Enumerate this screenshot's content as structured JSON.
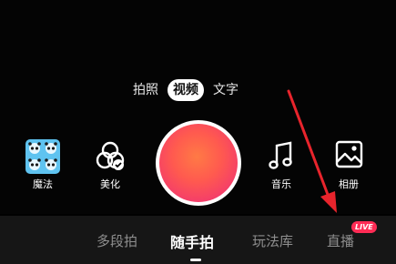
{
  "mode_tabs": {
    "photo": "拍照",
    "video": "视频",
    "text": "文字"
  },
  "tools": {
    "magic": "魔法",
    "beautify": "美化",
    "music": "音乐",
    "album": "相册"
  },
  "bottom_nav": {
    "multi_segment": "多段拍",
    "casual": "随手拍",
    "templates": "玩法库",
    "live": "直播",
    "live_badge": "LIVE"
  },
  "colors": {
    "shutter_gradient_start": "#ff7a45",
    "shutter_gradient_end": "#ea2e7a",
    "live_badge": "#fe2c55",
    "annotation_arrow": "#e8242c"
  }
}
